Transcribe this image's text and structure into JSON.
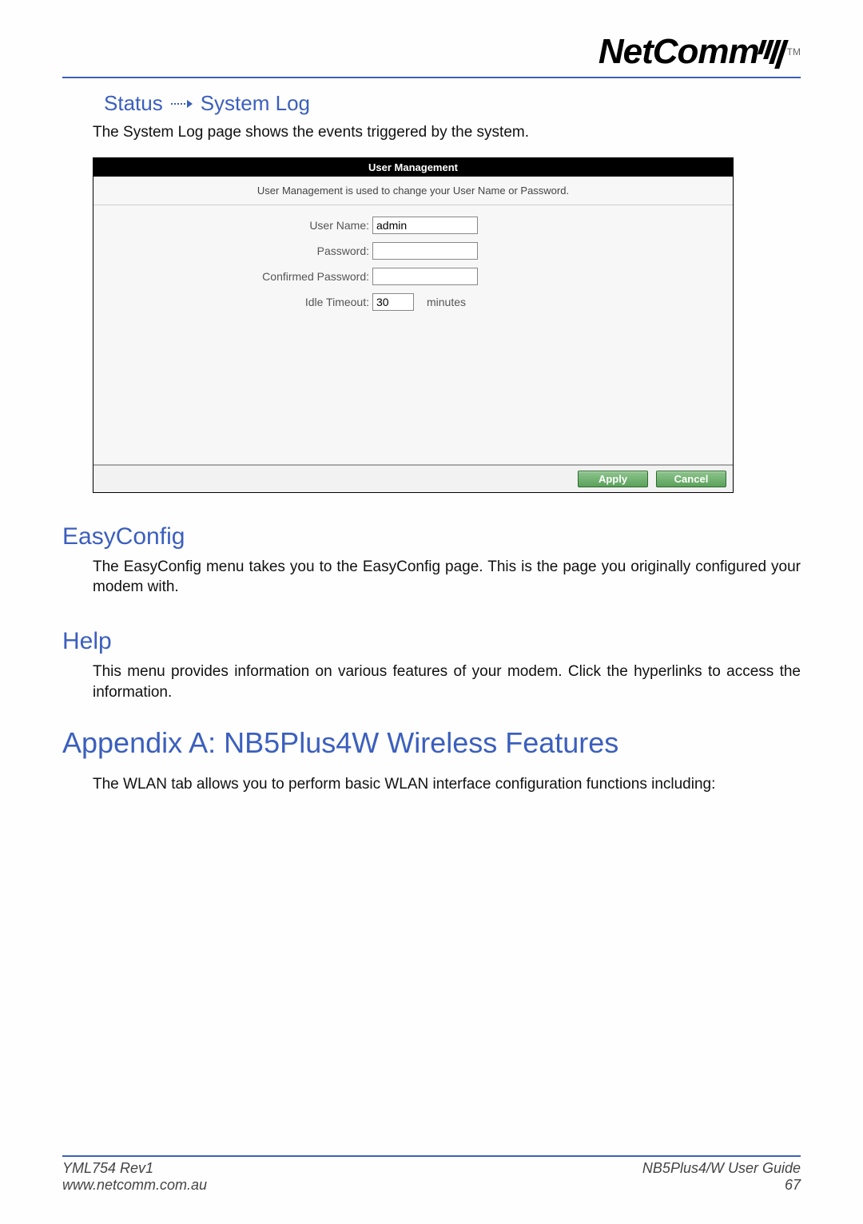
{
  "branding": {
    "logo_text": "NetComm",
    "tm": "TM"
  },
  "section_status": {
    "breadcrumb_left": "Status",
    "breadcrumb_right": "System Log",
    "intro": "The System Log page shows the events triggered by the system."
  },
  "panel": {
    "title": "User Management",
    "description": "User Management is used to change your User Name or Password.",
    "fields": {
      "username_label": "User Name:",
      "username_value": "admin",
      "password_label": "Password:",
      "password_value": "",
      "confirm_label": "Confirmed Password:",
      "confirm_value": "",
      "timeout_label": "Idle Timeout:",
      "timeout_value": "30",
      "timeout_unit": "minutes"
    },
    "buttons": {
      "apply": "Apply",
      "cancel": "Cancel"
    }
  },
  "section_easyconfig": {
    "heading": "EasyConfig",
    "text": "The EasyConfig menu takes you to the EasyConfig page. This is the page you originally configured your modem with."
  },
  "section_help": {
    "heading": "Help",
    "text": "This menu provides information on various features of your modem. Click the hyperlinks to access the information."
  },
  "section_appendix": {
    "heading": "Appendix A: NB5Plus4W Wireless Features",
    "text": "The WLAN tab allows you to perform basic WLAN interface configuration functions including:"
  },
  "footer": {
    "left_top": "YML754 Rev1",
    "left_bottom": "www.netcomm.com.au",
    "right_top": "NB5Plus4/W User Guide",
    "right_bottom": "67"
  }
}
